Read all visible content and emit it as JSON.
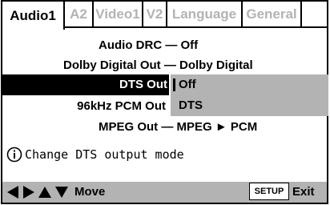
{
  "tabs": [
    {
      "label": "Audio1",
      "active": true
    },
    {
      "label": "A2",
      "active": false
    },
    {
      "label": "Video1",
      "active": false
    },
    {
      "label": "V2",
      "active": false
    },
    {
      "label": "Language",
      "active": false
    },
    {
      "label": "General",
      "active": false
    }
  ],
  "menu": {
    "audio_drc": "Audio DRC — Off",
    "dolby_digital_out": "Dolby Digital Out — Dolby Digital",
    "dts_out_label": "DTS Out",
    "pcm_96khz_label": "96kHz PCM Out",
    "mpeg_out": "MPEG Out — MPEG ► PCM"
  },
  "dropdown": {
    "options": [
      "Off",
      "DTS"
    ],
    "selected": "Off"
  },
  "info": {
    "icon": "info-icon",
    "text": "Change DTS output mode"
  },
  "bottom": {
    "arrows_icon": "arrow-keys-icon",
    "move_label": "Move",
    "setup_label": "SETUP",
    "exit_label": "Exit"
  },
  "colors": {
    "highlight_bg": "#000000",
    "dropdown_bg": "#b3b3b3",
    "inactive_tab_text": "#b3b3b3"
  }
}
